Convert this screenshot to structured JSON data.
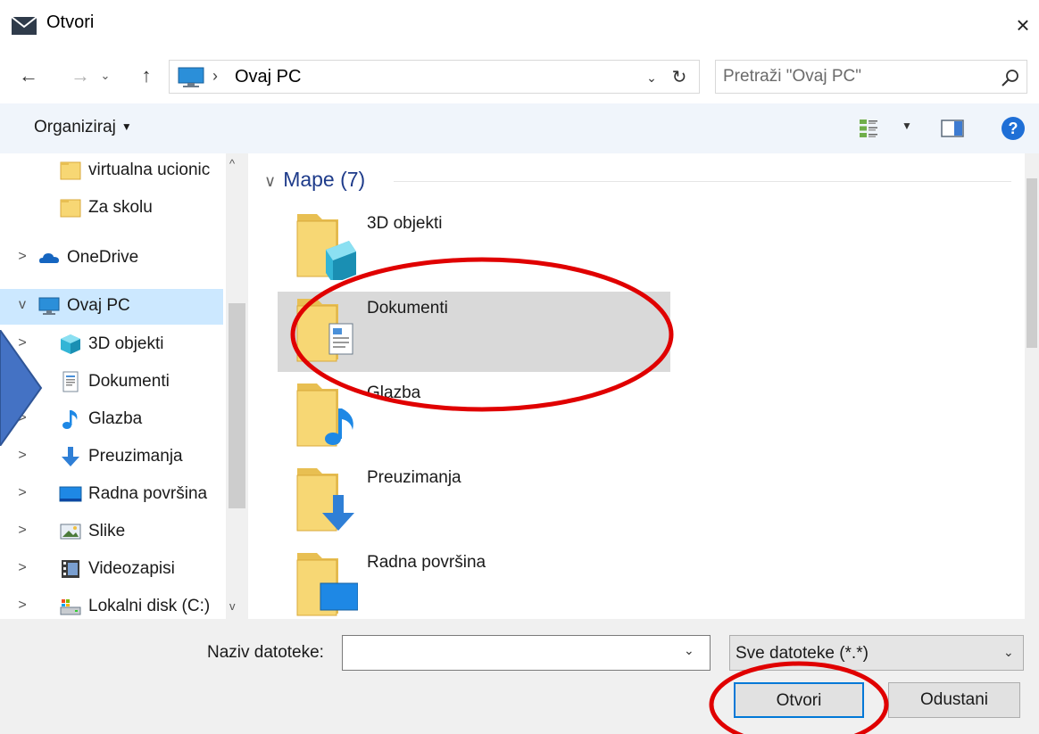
{
  "window": {
    "title": "Otvori",
    "close_glyph": "×"
  },
  "nav": {
    "back_glyph": "←",
    "forward_glyph": "→",
    "recent_glyph": "⌄",
    "up_glyph": "↑",
    "address_sep": "›",
    "address_path": "Ovaj PC",
    "address_dropdown_glyph": "⌄",
    "refresh_glyph": "↻",
    "search_placeholder": "Pretraži \"Ovaj PC\""
  },
  "toolbar": {
    "organize_label": "Organiziraj",
    "caret": "▼",
    "help_glyph": "?"
  },
  "navpane": {
    "scroll_up": "^",
    "scroll_down": "v",
    "items": [
      {
        "label": "virtualna ucionic",
        "expand": "",
        "icon": "folder-icon",
        "indent": 1
      },
      {
        "label": "Za skolu",
        "expand": "",
        "icon": "folder-icon",
        "indent": 1
      },
      {
        "label": "OneDrive",
        "expand": ">",
        "icon": "onedrive-icon",
        "indent": 0
      },
      {
        "label": "Ovaj PC",
        "expand": "v",
        "icon": "computer-icon",
        "indent": 0,
        "selected": true
      },
      {
        "label": "3D objekti",
        "expand": ">",
        "icon": "cube-3d-icon",
        "indent": 1
      },
      {
        "label": "Dokumenti",
        "expand": ">",
        "icon": "documents-icon",
        "indent": 1
      },
      {
        "label": "Glazba",
        "expand": ">",
        "icon": "music-note-icon",
        "indent": 1
      },
      {
        "label": "Preuzimanja",
        "expand": ">",
        "icon": "download-arrow-icon",
        "indent": 1
      },
      {
        "label": "Radna površina",
        "expand": ">",
        "icon": "desktop-icon",
        "indent": 1
      },
      {
        "label": "Slike",
        "expand": ">",
        "icon": "pictures-icon",
        "indent": 1
      },
      {
        "label": "Videozapisi",
        "expand": ">",
        "icon": "video-icon",
        "indent": 1
      },
      {
        "label": "Lokalni disk (C:)",
        "expand": ">",
        "icon": "local-disk-icon",
        "indent": 1
      }
    ]
  },
  "content": {
    "group_chevron": "∨",
    "group_label": "Mape (7)",
    "folders": [
      {
        "label": "3D objekti",
        "icon": "cube-3d-icon"
      },
      {
        "label": "Dokumenti",
        "icon": "documents-icon",
        "selected": true
      },
      {
        "label": "Glazba",
        "icon": "music-note-icon"
      },
      {
        "label": "Preuzimanja",
        "icon": "download-arrow-icon"
      },
      {
        "label": "Radna površina",
        "icon": "desktop-icon"
      }
    ]
  },
  "footer": {
    "filename_label": "Naziv datoteke:",
    "filename_value": "",
    "filename_dropdown_glyph": "⌄",
    "filter_value": "Sve datoteke (*.*)",
    "filter_caret": "⌄",
    "open_label": "Otvori",
    "cancel_label": "Odustani"
  },
  "colors": {
    "selection": "#cce8ff",
    "selected_folder": "#d9d9d9",
    "accent_blue": "#0078d7",
    "annotation_red": "#e00000",
    "annotation_arrow": "#4472c4"
  }
}
